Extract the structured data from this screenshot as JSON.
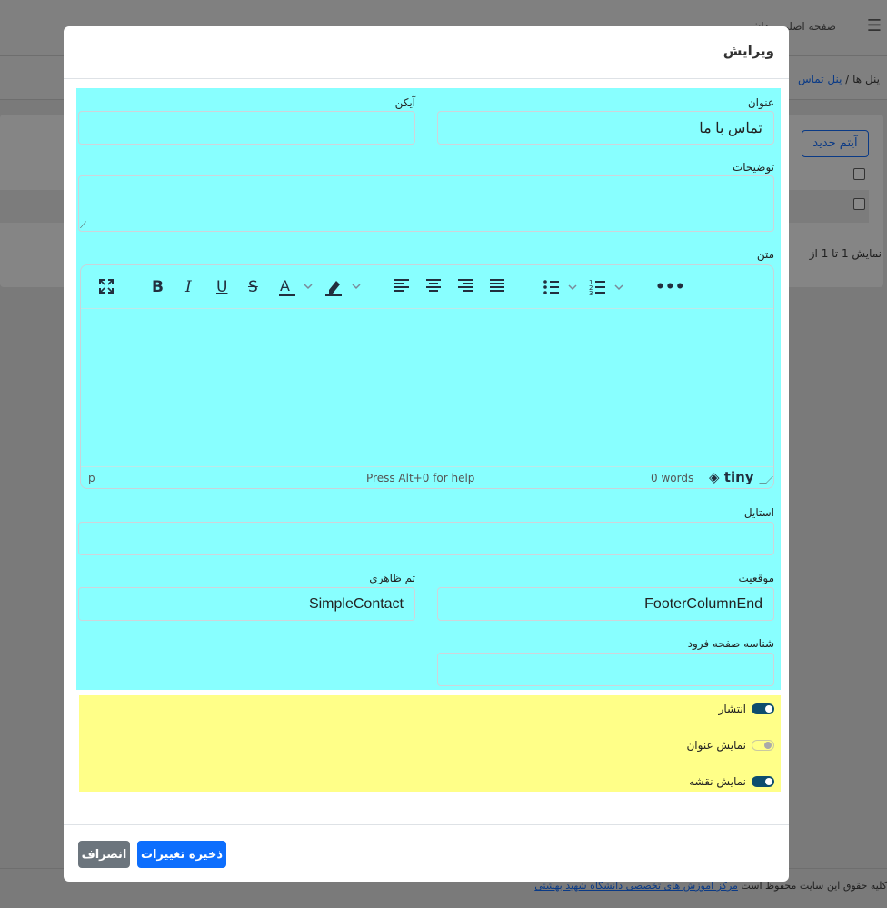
{
  "background": {
    "menu_icon": "hamburger-icon",
    "nav_home": "صفحه اصلی",
    "nav_second": "داشبورد",
    "breadcrumb_root": "پنل ها",
    "breadcrumb_sep": "/",
    "breadcrumb_current": "پنل تماس",
    "new_item_button": "آیتم جدید",
    "pagination_info": "نمایش 1 تا 1 از",
    "footer_prefix": "کلیه حقوق این سایت محفوظ است",
    "footer_link": "مرکز آموزش های تخصصی دانشگاه شهید بهشتی"
  },
  "modal": {
    "title": "ویرایش",
    "fields": {
      "title_label": "عنوان",
      "title_value": "تماس با ما",
      "icon_label": "آیکن",
      "icon_value": "",
      "description_label": "توضیحات",
      "description_value": "",
      "text_label": "متن",
      "style_label": "استایل",
      "style_value": "",
      "position_label": "موقعیت",
      "position_value": "FooterColumnEnd",
      "theme_label": "تم ظاهری",
      "theme_value": "SimpleContact",
      "landing_id_label": "شناسه صفحه فرود",
      "landing_id_value": ""
    },
    "editor": {
      "toolbar": [
        "fullscreen-icon",
        "bold-icon",
        "italic-icon",
        "underline-icon",
        "strikethrough-icon",
        "text-color-icon",
        "highlight-icon",
        "align-left-icon",
        "align-center-icon",
        "align-right-icon",
        "justify-icon",
        "bullet-list-icon",
        "numbered-list-icon",
        "more-icon"
      ],
      "path": "p",
      "help": "Press Alt+0 for help",
      "word_count": "0 words",
      "brand": "tiny"
    },
    "toggles": [
      {
        "label": "انتشار",
        "on": true
      },
      {
        "label": "نمایش عنوان",
        "on": false
      },
      {
        "label": "نمایش نقشه",
        "on": true
      }
    ],
    "save_button": "ذخیره تغییرات",
    "cancel_button": "انصراف"
  }
}
